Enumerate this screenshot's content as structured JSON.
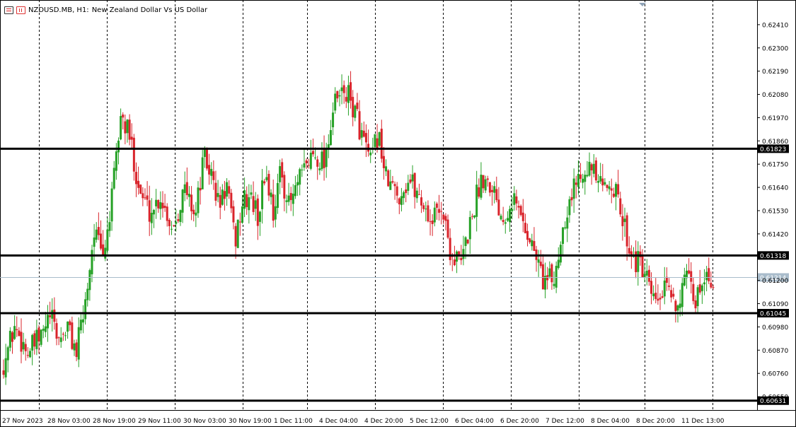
{
  "header": {
    "symbol": "NZDUSD.MB, H1:",
    "description": "New Zealand Dollar Vs US Dollar",
    "icons": [
      "chart-list-icon",
      "chart-properties-icon"
    ]
  },
  "colors": {
    "up_candle": "#26a126",
    "down_candle": "#d9242b",
    "wick": "#555555",
    "level_line": "#000000",
    "current_price_line": "#a9bccb",
    "grid": "#000000"
  },
  "chart_data": {
    "type": "candlestick",
    "title": "NZDUSD.MB, H1: New Zealand Dollar Vs US Dollar",
    "timeframe": "H1",
    "xlabel": "",
    "ylabel": "",
    "ylim": [
      0.6059,
      0.6252
    ],
    "y_ticks": [
      "0.62410",
      "0.62300",
      "0.62190",
      "0.62080",
      "0.61970",
      "0.61860",
      "0.61750",
      "0.61640",
      "0.61530",
      "0.61420",
      "0.61200",
      "0.61090",
      "0.60980",
      "0.60870",
      "0.60760",
      "0.60650"
    ],
    "x_tick_labels": [
      "27 Nov 2023",
      "28 Nov 03:00",
      "28 Nov 19:00",
      "29 Nov 11:00",
      "30 Nov 03:00",
      "30 Nov 19:00",
      "1 Dec 11:00",
      "4 Dec 04:00",
      "4 Dec 20:00",
      "5 Dec 12:00",
      "6 Dec 04:00",
      "6 Dec 20:00",
      "7 Dec 12:00",
      "8 Dec 04:00",
      "8 Dec 20:00",
      "11 Dec 13:00"
    ],
    "horizontal_levels": [
      {
        "value": 0.61823,
        "label": "0.61823"
      },
      {
        "value": 0.61318,
        "label": "0.61318"
      },
      {
        "value": 0.61045,
        "label": "0.61045"
      },
      {
        "value": 0.60631,
        "label": "0.60631"
      }
    ],
    "current_price": {
      "value": 0.61214,
      "label": "0.61214"
    },
    "grid": "vertical dashed",
    "segments": [
      {
        "bars": 18,
        "path": [
          0.6078,
          0.6098,
          0.6086,
          0.6093
        ]
      },
      {
        "bars": 16,
        "path": [
          0.6093,
          0.6103,
          0.6092,
          0.6098,
          0.6086
        ]
      },
      {
        "bars": 12,
        "path": [
          0.6086,
          0.611,
          0.6144,
          0.613
        ]
      },
      {
        "bars": 12,
        "path": [
          0.613,
          0.6158,
          0.6198,
          0.6188
        ]
      },
      {
        "bars": 14,
        "path": [
          0.6188,
          0.6162,
          0.6152,
          0.616
        ]
      },
      {
        "bars": 16,
        "path": [
          0.616,
          0.6145,
          0.6163,
          0.6152
        ]
      },
      {
        "bars": 14,
        "path": [
          0.6152,
          0.6178,
          0.617,
          0.6155,
          0.6165
        ]
      },
      {
        "bars": 14,
        "path": [
          0.6165,
          0.6138,
          0.6156,
          0.616,
          0.615
        ]
      },
      {
        "bars": 14,
        "path": [
          0.615,
          0.6172,
          0.6153,
          0.6172,
          0.6155
        ]
      },
      {
        "bars": 16,
        "path": [
          0.6155,
          0.6168,
          0.618,
          0.6177
        ]
      },
      {
        "bars": 14,
        "path": [
          0.6177,
          0.6203,
          0.621,
          0.62
        ]
      },
      {
        "bars": 14,
        "path": [
          0.62,
          0.6187,
          0.6175,
          0.619,
          0.6168
        ]
      },
      {
        "bars": 16,
        "path": [
          0.6168,
          0.616,
          0.6168,
          0.6158
        ]
      },
      {
        "bars": 18,
        "path": [
          0.6158,
          0.6148,
          0.6156,
          0.6132,
          0.6128
        ]
      },
      {
        "bars": 14,
        "path": [
          0.6128,
          0.615,
          0.617,
          0.6166
        ]
      },
      {
        "bars": 14,
        "path": [
          0.6166,
          0.615,
          0.616,
          0.6148
        ]
      },
      {
        "bars": 14,
        "path": [
          0.6148,
          0.6135,
          0.612,
          0.612
        ]
      },
      {
        "bars": 14,
        "path": [
          0.612,
          0.615,
          0.6165,
          0.6176
        ]
      },
      {
        "bars": 12,
        "path": [
          0.6176,
          0.617,
          0.6162,
          0.6168
        ]
      },
      {
        "bars": 14,
        "path": [
          0.6168,
          0.615,
          0.6132,
          0.6125
        ]
      },
      {
        "bars": 16,
        "path": [
          0.6125,
          0.6108,
          0.6115,
          0.611
        ]
      },
      {
        "bars": 16,
        "path": [
          0.611,
          0.612,
          0.611,
          0.6124,
          0.6121
        ]
      }
    ]
  }
}
